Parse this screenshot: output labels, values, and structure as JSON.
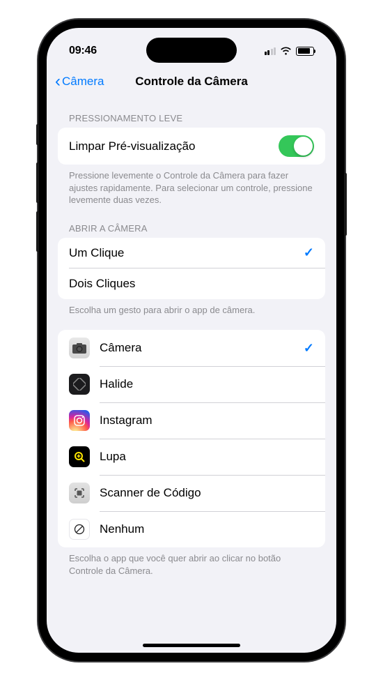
{
  "statusBar": {
    "time": "09:46"
  },
  "nav": {
    "back": "Câmera",
    "title": "Controle da Câmera"
  },
  "section1": {
    "header": "PRESSIONAMENTO LEVE",
    "row": "Limpar Pré-visualização",
    "footer": "Pressione levemente o Controle da Câmera para fazer ajustes rapidamente. Para selecionar um controle, pressione levemente duas vezes."
  },
  "section2": {
    "header": "ABRIR A CÂMERA",
    "options": [
      "Um Clique",
      "Dois Cliques"
    ],
    "footer": "Escolha um gesto para abrir o app de câmera."
  },
  "section3": {
    "apps": [
      "Câmera",
      "Halide",
      "Instagram",
      "Lupa",
      "Scanner de Código",
      "Nenhum"
    ],
    "footer": "Escolha o app que você quer abrir ao clicar no botão Controle da Câmera."
  }
}
